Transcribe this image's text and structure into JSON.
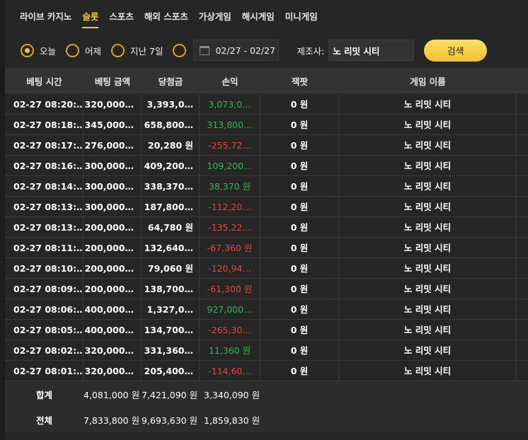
{
  "tabs": [
    {
      "label": "라이브 카지노",
      "active": false
    },
    {
      "label": "슬롯",
      "active": true
    },
    {
      "label": "스포츠",
      "active": false
    },
    {
      "label": "해외 스포츠",
      "active": false
    },
    {
      "label": "가상게임",
      "active": false
    },
    {
      "label": "해시게임",
      "active": false
    },
    {
      "label": "미니게임",
      "active": false
    }
  ],
  "filters": {
    "today": "오늘",
    "yesterday": "어제",
    "last7": "지난 7일",
    "date_range": "02/27 - 02/27",
    "manufacturer_label": "제조사:",
    "manufacturer_value": "노 리밋 시티",
    "search_label": "검색"
  },
  "columns": [
    "베팅 시간",
    "베팅 금액",
    "당첨금",
    "손익",
    "잭팟",
    "게임 이름"
  ],
  "rows": [
    {
      "time": "02-27 08:20:…",
      "bet": "320,000…",
      "win": "3,393,0…",
      "pl": "3,073,0…",
      "pl_sign": "pos",
      "jackpot": "0 원",
      "game": "노 리밋 시티"
    },
    {
      "time": "02-27 08:18:…",
      "bet": "345,000…",
      "win": "658,800…",
      "pl": "313,800…",
      "pl_sign": "pos",
      "jackpot": "0 원",
      "game": "노 리밋 시티"
    },
    {
      "time": "02-27 08:17:…",
      "bet": "276,000…",
      "win": "20,280 원",
      "pl": "-255,72…",
      "pl_sign": "neg",
      "jackpot": "0 원",
      "game": "노 리밋 시티"
    },
    {
      "time": "02-27 08:16:…",
      "bet": "300,000…",
      "win": "409,200…",
      "pl": "109,200…",
      "pl_sign": "pos",
      "jackpot": "0 원",
      "game": "노 리밋 시티"
    },
    {
      "time": "02-27 08:14:…",
      "bet": "300,000…",
      "win": "338,370…",
      "pl": "38,370 원",
      "pl_sign": "pos",
      "jackpot": "0 원",
      "game": "노 리밋 시티"
    },
    {
      "time": "02-27 08:13:…",
      "bet": "300,000…",
      "win": "187,800…",
      "pl": "-112,20…",
      "pl_sign": "neg",
      "jackpot": "0 원",
      "game": "노 리밋 시티"
    },
    {
      "time": "02-27 08:13:…",
      "bet": "200,000…",
      "win": "64,780 원",
      "pl": "-135,22…",
      "pl_sign": "neg",
      "jackpot": "0 원",
      "game": "노 리밋 시티"
    },
    {
      "time": "02-27 08:11:…",
      "bet": "200,000…",
      "win": "132,640…",
      "pl": "-67,360 원",
      "pl_sign": "neg",
      "jackpot": "0 원",
      "game": "노 리밋 시티"
    },
    {
      "time": "02-27 08:10:…",
      "bet": "200,000…",
      "win": "79,060 원",
      "pl": "-120,94…",
      "pl_sign": "neg",
      "jackpot": "0 원",
      "game": "노 리밋 시티"
    },
    {
      "time": "02-27 08:09:…",
      "bet": "200,000…",
      "win": "138,700…",
      "pl": "-61,300 원",
      "pl_sign": "neg",
      "jackpot": "0 원",
      "game": "노 리밋 시티"
    },
    {
      "time": "02-27 08:06:…",
      "bet": "400,000…",
      "win": "1,327,0…",
      "pl": "927,000…",
      "pl_sign": "pos",
      "jackpot": "0 원",
      "game": "노 리밋 시티"
    },
    {
      "time": "02-27 08:05:…",
      "bet": "400,000…",
      "win": "134,700…",
      "pl": "-265,30…",
      "pl_sign": "neg",
      "jackpot": "0 원",
      "game": "노 리밋 시티"
    },
    {
      "time": "02-27 08:02:…",
      "bet": "320,000…",
      "win": "331,360…",
      "pl": "11,360 원",
      "pl_sign": "pos",
      "jackpot": "0 원",
      "game": "노 리밋 시티"
    },
    {
      "time": "02-27 08:01:…",
      "bet": "320,000…",
      "win": "205,400…",
      "pl": "-114,60…",
      "pl_sign": "neg",
      "jackpot": "0 원",
      "game": "노 리밋 시티"
    }
  ],
  "summary": [
    {
      "label": "합계",
      "bet": "4,081,000 원",
      "win": "7,421,090 원",
      "pl": "3,340,090 원"
    },
    {
      "label": "전체",
      "bet": "7,833,800 원",
      "win": "9,693,630 원",
      "pl": "1,859,830 원"
    }
  ],
  "colors": {
    "accent": "#f5c542",
    "positive": "#2eb84f",
    "negative": "#e8443a"
  }
}
